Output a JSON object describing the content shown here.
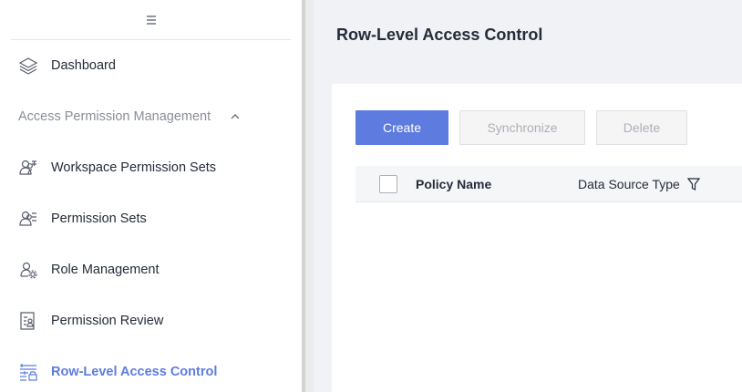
{
  "sidebar": {
    "collapse_icon": "menu-collapse-icon",
    "items": [
      {
        "label": "Dashboard",
        "icon": "layers-icon"
      },
      {
        "label": "Access Permission Management",
        "icon": "chevron-up-icon",
        "is_group": true
      },
      {
        "label": "Workspace Permission Sets",
        "icon": "users-permission-icon"
      },
      {
        "label": "Permission Sets",
        "icon": "user-list-icon"
      },
      {
        "label": "Role Management",
        "icon": "user-gear-icon"
      },
      {
        "label": "Permission Review",
        "icon": "document-user-icon"
      },
      {
        "label": "Row-Level Access Control",
        "icon": "row-lock-icon",
        "active": true
      }
    ]
  },
  "main": {
    "title": "Row-Level Access Control",
    "toolbar": {
      "create_label": "Create",
      "sync_label": "Synchronize",
      "delete_label": "Delete"
    },
    "table": {
      "columns": [
        "Policy Name",
        "Data Source Type"
      ],
      "filter_icon": "filter-icon"
    }
  },
  "colors": {
    "accent": "#5e7ce0",
    "text": "#252b3a",
    "muted": "#8a8e99",
    "page_bg": "#f1f2f5"
  }
}
